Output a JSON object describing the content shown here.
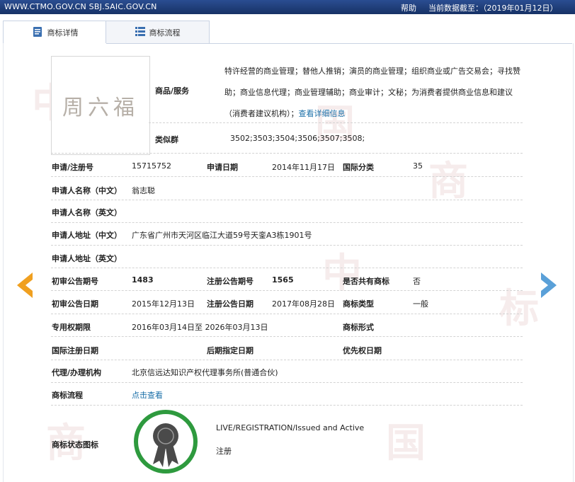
{
  "topbar": {
    "url": "WWW.CTMO.GOV.CN SBJ.SAIC.GOV.CN",
    "help": "帮助",
    "data_date": "当前数据截至：（2019年01月12日）"
  },
  "tabs": [
    {
      "label": "商标详情",
      "icon": "document-icon",
      "active": true
    },
    {
      "label": "商标流程",
      "icon": "list-icon",
      "active": false
    }
  ],
  "logo": {
    "text": "周六福"
  },
  "goods": {
    "label": "商品/服务",
    "text": "特许经营的商业管理；替他人推销；演员的商业管理；组织商业或广告交易会；寻找赞助；商业信息代理；商业管理辅助；商业审计；文秘；为消费者提供商业信息和建议（消费者建议机构）；",
    "more_link": "查看详细信息"
  },
  "similar_group": {
    "label": "类似群",
    "value": "3502;3503;3504;3506;3507;3508;"
  },
  "fields": {
    "reg_no_label": "申请/注册号",
    "reg_no": "15715752",
    "app_date_label": "申请日期",
    "app_date": "2014年11月17日",
    "intl_class_label": "国际分类",
    "intl_class": "35",
    "applicant_cn_label": "申请人名称（中文）",
    "applicant_cn": "翁志聪",
    "applicant_en_label": "申请人名称（英文）",
    "address_cn_label": "申请人地址（中文）",
    "address_cn": "广东省广州市天河区临江大道59号天銮A3栋1901号",
    "address_en_label": "申请人地址（英文）",
    "prelim_no_label": "初审公告期号",
    "prelim_no": "1483",
    "reg_pub_no_label": "注册公告期号",
    "reg_pub_no": "1565",
    "shared_label": "是否共有商标",
    "shared": "否",
    "prelim_date_label": "初审公告日期",
    "prelim_date": "2015年12月13日",
    "reg_pub_date_label": "注册公告日期",
    "reg_pub_date": "2017年08月28日",
    "mark_type_label": "商标类型",
    "mark_type": "一般",
    "exclusive_label": "专用权期限",
    "exclusive": "2016年03月14日至 2026年03月13日",
    "mark_form_label": "商标形式",
    "intl_reg_date_label": "国际注册日期",
    "later_date_label": "后期指定日期",
    "priority_date_label": "优先权日期",
    "agent_label": "代理/办理机构",
    "agent": "北京信远达知识产权代理事务所(普通合伙)",
    "process_label": "商标流程",
    "process_link": "点击查看",
    "status_label": "商标状态图标",
    "status_en": "LIVE/REGISTRATION/Issued and Active",
    "status_cn": "注册"
  },
  "watermark": "中国商标",
  "colors": {
    "topbar": "#1f3d7a",
    "prev_arrow": "#f0a020",
    "next_arrow": "#5aa0d8",
    "badge_ring": "#2e9a3e",
    "link": "#1a6fa8"
  }
}
